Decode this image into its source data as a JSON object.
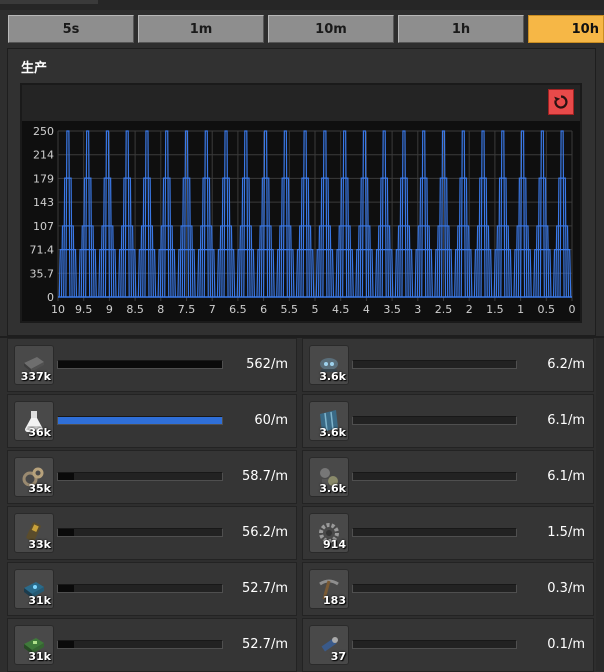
{
  "tabs": [
    {
      "label": "5s",
      "active": false
    },
    {
      "label": "1m",
      "active": false
    },
    {
      "label": "10m",
      "active": false
    },
    {
      "label": "1h",
      "active": false
    },
    {
      "label": "10h",
      "active": true
    }
  ],
  "panel": {
    "title": "生产"
  },
  "chart_data": {
    "type": "line",
    "yticks": [
      "250",
      "214",
      "179",
      "143",
      "107",
      "71.4",
      "35.7",
      "0"
    ],
    "xticks": [
      "10",
      "9.5",
      "9",
      "8.5",
      "8",
      "7.5",
      "7",
      "6.5",
      "6",
      "5.5",
      "5",
      "4.5",
      "4",
      "3.5",
      "3",
      "2.5",
      "2",
      "1.5",
      "1",
      "0.5",
      "0"
    ],
    "ylim": [
      0,
      250
    ],
    "xlim": [
      10,
      0
    ],
    "series": [
      {
        "color": "#3a78e6",
        "pulse_peaks": 26,
        "peak_values": [
          250,
          179,
          107,
          71.4
        ]
      }
    ],
    "grid": true
  },
  "rows_left": [
    {
      "icon": "stone-brick-icon",
      "count": "337k",
      "rate": "562/m",
      "fill": 1.0,
      "blue": false
    },
    {
      "icon": "science-flask-icon",
      "count": "36k",
      "rate": "60/m",
      "fill": 1.0,
      "blue": true
    },
    {
      "icon": "gear-chain-icon",
      "count": "35k",
      "rate": "58.7/m",
      "fill": 0.1,
      "blue": false
    },
    {
      "icon": "ammo-magazine-icon",
      "count": "33k",
      "rate": "56.2/m",
      "fill": 0.1,
      "blue": false
    },
    {
      "icon": "blue-chip-icon",
      "count": "31k",
      "rate": "52.7/m",
      "fill": 0.1,
      "blue": false
    },
    {
      "icon": "green-circuit-icon",
      "count": "31k",
      "rate": "52.7/m",
      "fill": 0.1,
      "blue": false
    }
  ],
  "rows_right": [
    {
      "icon": "robot-drone-icon",
      "count": "3.6k",
      "rate": "6.2/m",
      "fill": 0.0,
      "blue": false
    },
    {
      "icon": "solar-panel-icon",
      "count": "3.6k",
      "rate": "6.1/m",
      "fill": 0.0,
      "blue": false
    },
    {
      "icon": "mech-assembly-icon",
      "count": "3.6k",
      "rate": "6.1/m",
      "fill": 0.0,
      "blue": false
    },
    {
      "icon": "cog-wheel-icon",
      "count": "914",
      "rate": "1.5/m",
      "fill": 0.0,
      "blue": false
    },
    {
      "icon": "pickaxe-icon",
      "count": "183",
      "rate": "0.3/m",
      "fill": 0.0,
      "blue": false
    },
    {
      "icon": "wrench-tool-icon",
      "count": "37",
      "rate": "0.1/m",
      "fill": 0.0,
      "blue": false
    }
  ]
}
